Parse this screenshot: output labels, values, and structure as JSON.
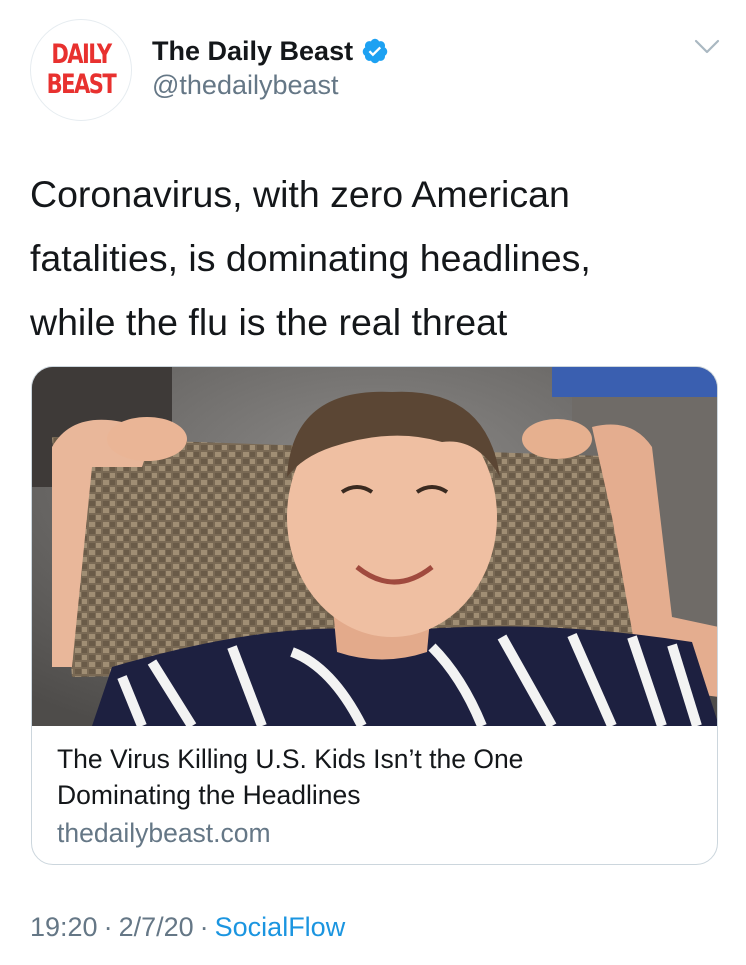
{
  "tweet": {
    "avatar": {
      "logo_line1": "DAILY",
      "logo_line2": "BEAST",
      "brand_color": "#e8312f"
    },
    "display_name": "The Daily Beast",
    "verified_icon": "verified-badge-icon",
    "handle": "@thedailybeast",
    "menu_icon": "chevron-down-icon",
    "text_lines": [
      "Coronavirus, with zero American",
      "fatalities, is dominating headlines,",
      "while the flu is the real threat"
    ],
    "card": {
      "image": "photo-smiling-boy-striped-shirt-wicker-chair",
      "title_lines": [
        "The Virus Killing U.S. Kids Isn’t the One",
        "Dominating the Headlines"
      ],
      "domain": "thedailybeast.com"
    },
    "footer": {
      "time": "19:20",
      "separator": "·",
      "date": "2/7/20",
      "source": "SocialFlow"
    }
  },
  "colors": {
    "text": "#14171a",
    "secondary": "#657786",
    "link": "#1b95e0",
    "verified": "#1da1f2",
    "border": "#ccd6dd"
  }
}
